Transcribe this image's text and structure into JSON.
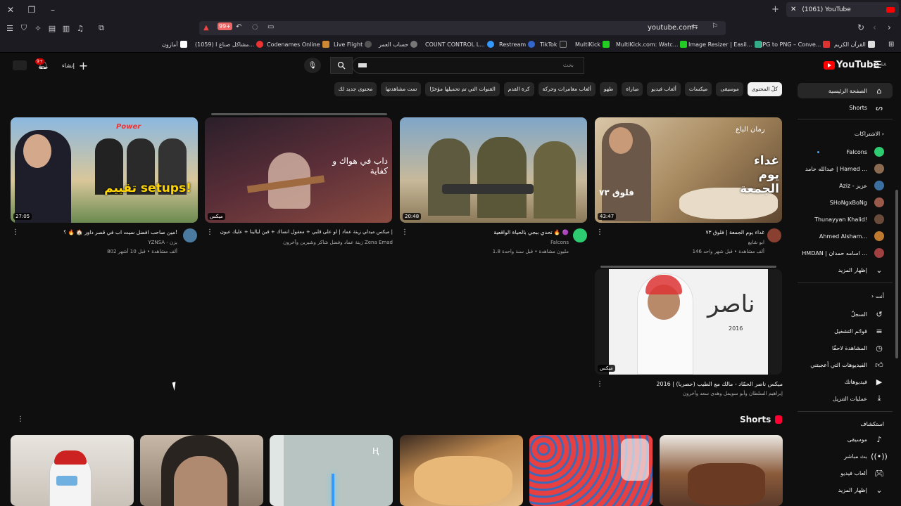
{
  "browser": {
    "tab_title": "(1061) YouTube",
    "url": "youtube.com",
    "bookmarks": [
      "أمازون",
      "(1059) مشاكل صناع ا...",
      "Codenames Online",
      "Live Flight",
      "حساب العمر",
      "COUNT CONTROL L...",
      "Restream",
      "TikTok",
      "MultiKick",
      "MultiKick.com: Watc...",
      "Image Resizer | Easil...",
      "JPG to PNG – Conve...",
      "القرآن الكريم"
    ]
  },
  "header": {
    "logo": "YouTube",
    "logo_region": "SA",
    "search_placeholder": "بحث",
    "create_label": "إنشاء",
    "notif_badge": "9+"
  },
  "chips": [
    "كلّ المحتوى",
    "موسيقى",
    "ميكسات",
    "ألعاب فيديو",
    "مباراة",
    "طهو",
    "ألعاب مغامرات وحركة",
    "كرة القدم",
    "القنوات التي تم تحميلها مؤخرًا",
    "تمت مشاهدتها",
    "محتوى جديد لك"
  ],
  "sidebar": {
    "home": "الصفحة الرئيسية",
    "shorts": "Shorts",
    "subs_title": "الاشتراكات",
    "subs": [
      {
        "name": "Falcons",
        "color": "#2ecc71"
      },
      {
        "name": "عبدالله حامد | Hamed ...",
        "color": "#8a6a50"
      },
      {
        "name": "Aziz - عزيز",
        "color": "#3a6fa0"
      },
      {
        "name": "SHoNgxBoNg",
        "color": "#9a5a4a"
      },
      {
        "name": "Thunayyan Khalid!",
        "color": "#6a4a3a"
      },
      {
        "name": "Ahmed Alsham...",
        "color": "#c07a30"
      },
      {
        "name": "HMDAN | اسامه حمدان ...",
        "color": "#a04040"
      }
    ],
    "show_more": "إظهار المزيد",
    "you_title": "أنت",
    "you_items": [
      "السجلّ",
      "قوائم التشغيل",
      "المشاهدة لاحقًا",
      "الفيديوهات التي أعجبتني",
      "فيديوهاتك",
      "عمليات التنزيل"
    ],
    "explore_title": "استكشاف",
    "explore_items": [
      "موسيقى",
      "بث مباشر",
      "ألعاب فيديو",
      "إظهار المزيد"
    ]
  },
  "videos": [
    {
      "title": "غداء يوم الجمعة | فلوق ٧٣",
      "channel": "ابو شايع",
      "meta": "146 ألف مشاهدة • قبل شهر واحد",
      "duration": "43:47"
    },
    {
      "title": "تحدي ببجي بالحياة الواقعية 🔥 🟣",
      "channel": "Falcons",
      "meta": "1.8 مليون مشاهدة • قبل سنة واحدة",
      "duration": "20:48"
    },
    {
      "title": "ميكس ميدلي زينة عماد | لو على قلبي + معقول انساك + فين ليالينا + عليك عيون |",
      "channel": "زينة عماد وفضل شاكر وشيرين وآخرون Zena Emad",
      "meta": "",
      "duration": "ميكس"
    },
    {
      "title": "مين صاحب افضل سيت اب في قصر داور 🏠 🔥 ؟!",
      "channel": "YZNSA - يزن",
      "meta": "802 ألف مشاهدة • قبل 10 أشهر",
      "duration": "27:05"
    },
    {
      "title": "ميكس ناصر الحمّاد - مالك مع الطيب (حصريا) | 2016",
      "channel": "إبراهيم السلطان وأبو سويمل وهدى سعد وآخرون",
      "meta": "",
      "duration": "ميكس"
    }
  ],
  "thumb_texts": {
    "t1_caption": "غداء يوم الجمعة",
    "t1_vlog": "فلوق ٧٣",
    "t1_corner": "رمان الباع",
    "t3_text": "داب في هواك و كفاية",
    "t4_big": "تقييم setups!",
    "t4_power": "Power",
    "t5_sig": "ناصر",
    "t5_year": "2016"
  },
  "shorts": {
    "title": "Shorts"
  }
}
